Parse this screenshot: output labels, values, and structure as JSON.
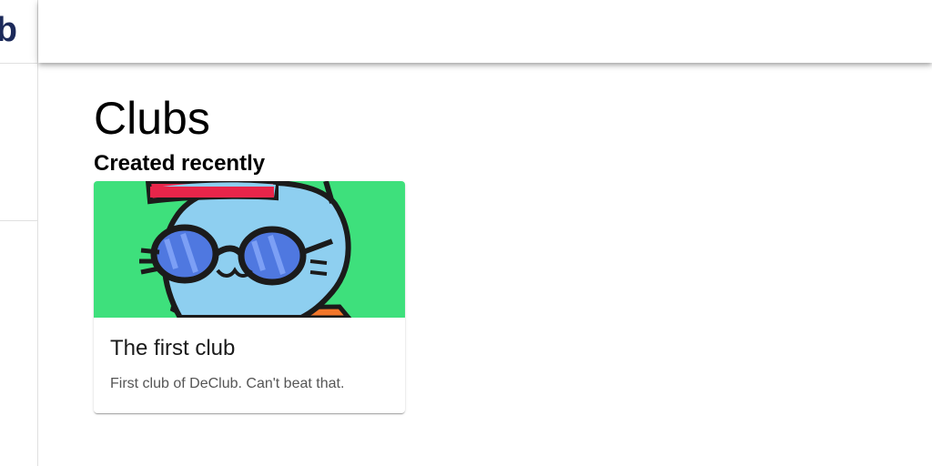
{
  "sidebar": {
    "brand": "DeClub"
  },
  "page": {
    "title": "Clubs",
    "section_title": "Created recently"
  },
  "clubs": [
    {
      "name": "The first club",
      "description": "First club of DeClub. Can't beat that.",
      "image": "cat-with-sunglasses-illustration"
    }
  ],
  "colors": {
    "brand": "#1c2a5a",
    "card_image_bg": "#3ee07c",
    "cat_body": "#8ecff0",
    "hat_red": "#e8254a",
    "glasses_blue": "#4f78e0"
  }
}
